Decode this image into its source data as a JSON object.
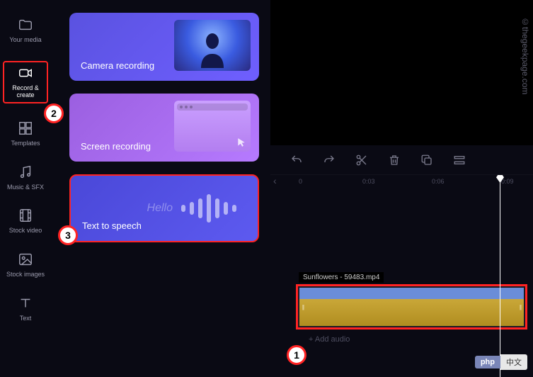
{
  "sidebar": {
    "items": [
      {
        "label": "Your media"
      },
      {
        "label": "Record &\ncreate"
      },
      {
        "label": "Templates"
      },
      {
        "label": "Music & SFX"
      },
      {
        "label": "Stock video"
      },
      {
        "label": "Stock images"
      },
      {
        "label": "Text"
      }
    ]
  },
  "cards": {
    "camera": "Camera recording",
    "screen": "Screen recording",
    "tts": "Text to speech",
    "hello": "Hello"
  },
  "badges": {
    "b1": "1",
    "b2": "2",
    "b3": "3"
  },
  "ruler": {
    "t0": "0",
    "t1": "0:03",
    "t2": "0:06",
    "t3": "0:09"
  },
  "clip": {
    "name": "Sunflowers - 59483.mp4"
  },
  "audio_hint": "+ Add audio",
  "watermark": "©thegeekpage.com",
  "footer": {
    "php": "php",
    "cn": "中文"
  }
}
